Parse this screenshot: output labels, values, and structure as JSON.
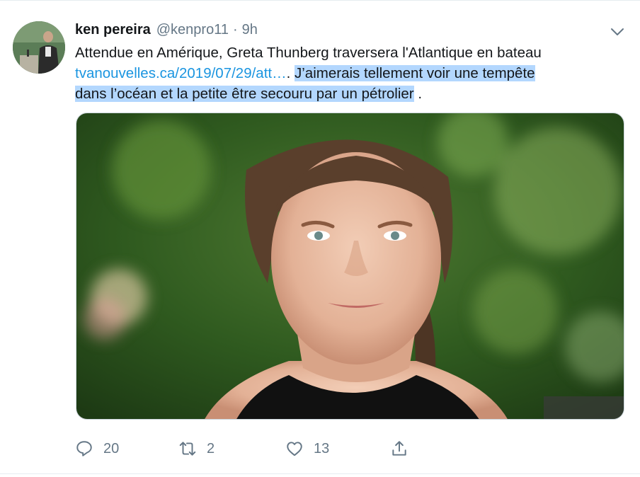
{
  "tweet": {
    "display_name": "ken pereira",
    "handle": "@kenpro11",
    "separator": "·",
    "time": "9h",
    "text_line1": "Attendue en Amérique, Greta Thunberg traversera l'Atlantique en bateau",
    "link_text": "tvanouvelles.ca/2019/07/29/att…",
    "text_after_link": ". ",
    "text_selected_1": "J’aimerais tellement voir une tempête",
    "text_selected_2": "dans l’océan et la petite être secouru par un pétrolier",
    "text_tail": " ."
  },
  "actions": {
    "reply_count": "20",
    "retweet_count": "2",
    "like_count": "13"
  },
  "icons": {
    "caret": "chevron-down-icon",
    "reply": "reply-icon",
    "retweet": "retweet-icon",
    "like": "heart-icon",
    "share": "share-icon"
  },
  "colors": {
    "link": "#1b95e0",
    "selection": "#b3d7fe",
    "secondary_text": "#657786",
    "border": "#e6ecf0"
  }
}
